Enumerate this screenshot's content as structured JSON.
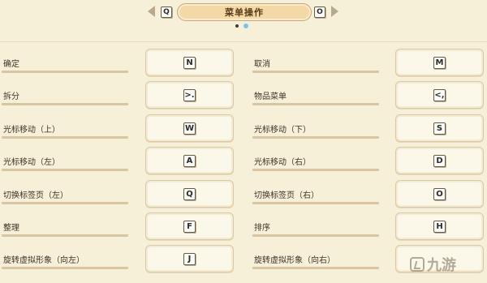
{
  "header": {
    "prev_key": "Q",
    "next_key": "O",
    "title": "菜单操作",
    "page_indicator": {
      "count": 2,
      "active": 2
    }
  },
  "rows": [
    {
      "left": {
        "label": "确定",
        "key": "N"
      },
      "right": {
        "label": "取消",
        "key": "M"
      }
    },
    {
      "left": {
        "label": "拆分",
        "key": ">."
      },
      "right": {
        "label": "物品菜单",
        "key": "<,"
      }
    },
    {
      "left": {
        "label": "光标移动（上）",
        "key": "W"
      },
      "right": {
        "label": "光标移动（下）",
        "key": "S"
      }
    },
    {
      "left": {
        "label": "光标移动（左）",
        "key": "A"
      },
      "right": {
        "label": "光标移动（右）",
        "key": "D"
      }
    },
    {
      "left": {
        "label": "切换标签页（左）",
        "key": "Q"
      },
      "right": {
        "label": "切换标签页（右）",
        "key": "O"
      }
    },
    {
      "left": {
        "label": "整理",
        "key": "F"
      },
      "right": {
        "label": "排序",
        "key": "H"
      }
    },
    {
      "left": {
        "label": "旋转虚拟形象（向左）",
        "key": "J"
      },
      "right": {
        "label": "旋转虚拟形象（向右）",
        "key": ""
      }
    }
  ],
  "watermark": {
    "text": "九游"
  },
  "colors": {
    "background": "#f7f0d9",
    "title_pill": "#f3d9a6",
    "active_dot": "#7cc3e6",
    "button_bg": "#fbf7e9"
  }
}
